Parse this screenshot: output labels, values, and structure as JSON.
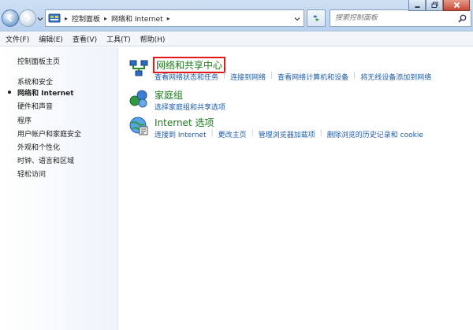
{
  "window": {
    "breadcrumbs": [
      "控制面板",
      "网络和 Internet"
    ],
    "search_placeholder": "搜索控制面板"
  },
  "menu": {
    "items": [
      "文件(F)",
      "编辑(E)",
      "查看(V)",
      "工具(T)",
      "帮助(H)"
    ]
  },
  "sidebar": {
    "home": "控制面板主页",
    "items": [
      "系统和安全",
      "网络和 Internet",
      "硬件和声音",
      "程序",
      "用户帐户和家庭安全",
      "外观和个性化",
      "时钟、语言和区域",
      "轻松访问"
    ],
    "current_index": 1
  },
  "categories": [
    {
      "title": "网络和共享中心",
      "icon": "network-sharing-center-icon",
      "highlighted": true,
      "tasks": [
        "查看网络状态和任务",
        "连接到网络",
        "查看网络计算机和设备",
        "将无线设备添加到网络"
      ]
    },
    {
      "title": "家庭组",
      "icon": "homegroup-icon",
      "tasks": [
        "选择家庭组和共享选项"
      ]
    },
    {
      "title": "Internet 选项",
      "icon": "internet-options-icon",
      "tasks": [
        "连接到 Internet",
        "更改主页",
        "管理浏览器加载项",
        "删除浏览的历史记录和 cookie"
      ]
    }
  ],
  "colors": {
    "category_title": "#1a7a1a",
    "task_link": "#1f5da8",
    "highlight_border": "#e01a1a"
  }
}
